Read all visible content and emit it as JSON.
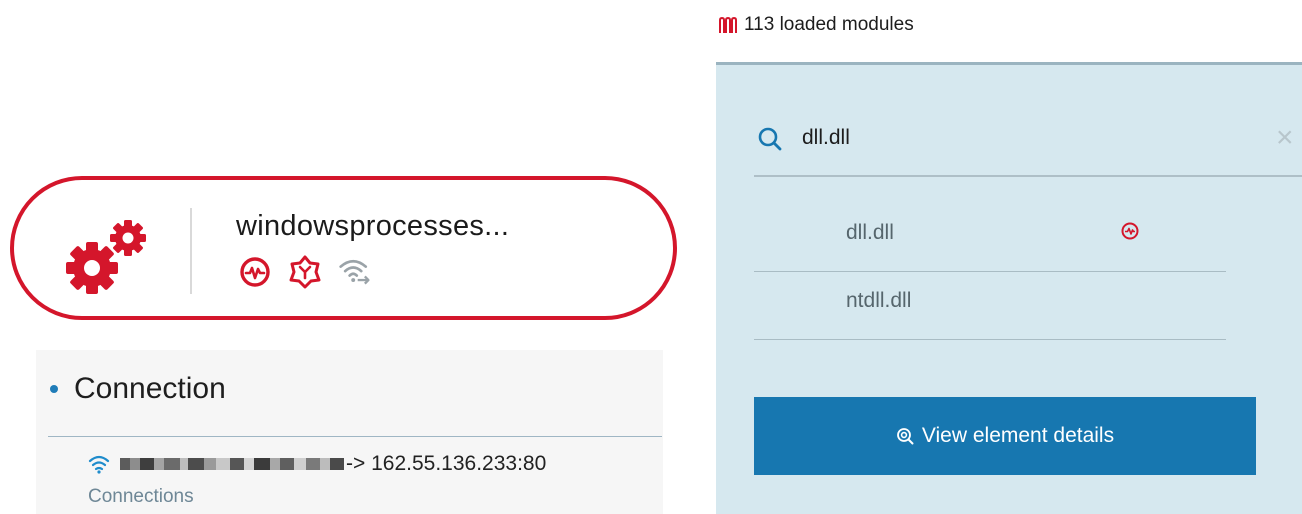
{
  "process": {
    "name": "windowsprocesses...",
    "icon": "gears-icon",
    "badges": [
      "activity-icon",
      "threat-shield-icon",
      "network-icon"
    ]
  },
  "connection": {
    "heading": "Connection",
    "destination": "-> 162.55.136.233:80",
    "link_label": "Connections"
  },
  "modules": {
    "count_label": "113 loaded modules",
    "search_value": "dll.dll",
    "clear_symbol": "×",
    "items": [
      {
        "label": "dll.dll",
        "flag": "activity-icon"
      },
      {
        "label": "ntdll.dll"
      }
    ],
    "details_button_label": "View element details"
  },
  "colors": {
    "accent_red": "#d4162b",
    "accent_blue": "#1777b0",
    "panel_bg": "#d6e8ef"
  }
}
